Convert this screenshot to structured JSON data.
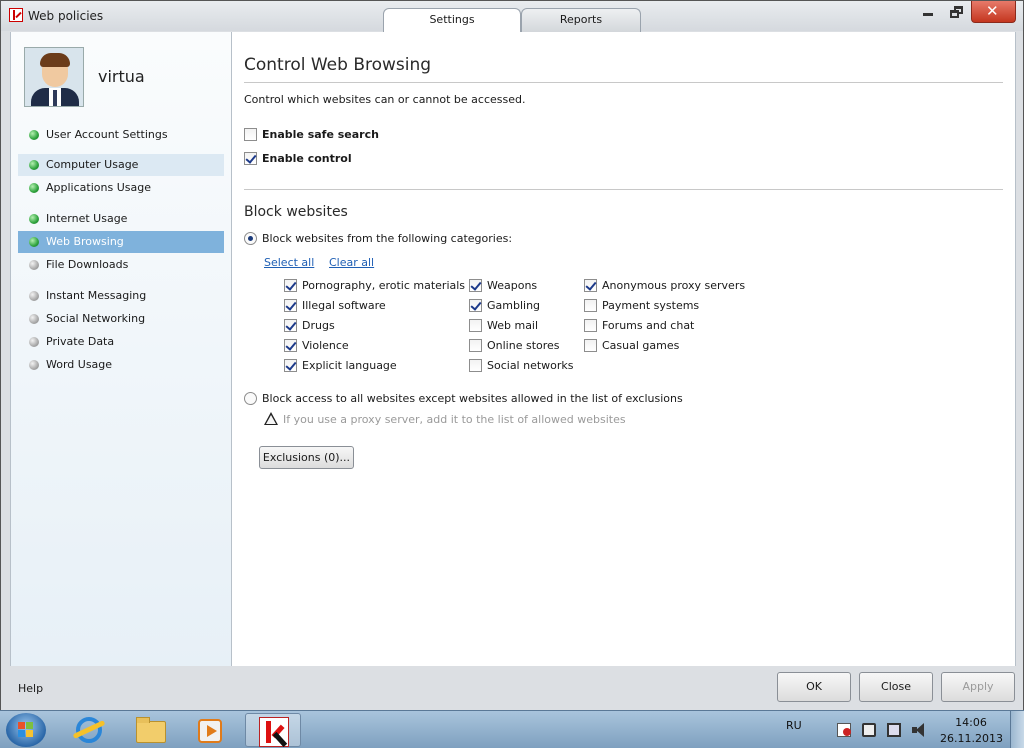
{
  "window": {
    "title": "Web policies",
    "tabs": [
      {
        "label": "Settings",
        "active": true
      },
      {
        "label": "Reports",
        "active": false
      }
    ],
    "close_glyph": "✕"
  },
  "sidebar": {
    "username": "virtua",
    "items": [
      {
        "label": "User Account Settings",
        "status": "green"
      },
      {
        "label": "Computer Usage",
        "status": "green",
        "state": "hover"
      },
      {
        "label": "Applications Usage",
        "status": "green"
      },
      {
        "label": "Internet Usage",
        "status": "green"
      },
      {
        "label": "Web Browsing",
        "status": "green",
        "state": "selected"
      },
      {
        "label": "File Downloads",
        "status": "gray"
      },
      {
        "label": "Instant Messaging",
        "status": "gray"
      },
      {
        "label": "Social Networking",
        "status": "gray"
      },
      {
        "label": "Private Data",
        "status": "gray"
      },
      {
        "label": "Word Usage",
        "status": "gray"
      }
    ]
  },
  "main": {
    "title": "Control Web Browsing",
    "description": "Control which websites can or cannot be accessed.",
    "enable_safe_search": {
      "label": "Enable safe search",
      "checked": false
    },
    "enable_control": {
      "label": "Enable control",
      "checked": true
    },
    "block_title": "Block websites",
    "radio_categories": {
      "label": "Block websites from the following categories:",
      "selected": true
    },
    "select_all": "Select all",
    "clear_all": "Clear all",
    "categories": [
      {
        "label": "Pornography, erotic materials",
        "checked": true
      },
      {
        "label": "Illegal software",
        "checked": true
      },
      {
        "label": "Drugs",
        "checked": true
      },
      {
        "label": "Violence",
        "checked": true
      },
      {
        "label": "Explicit language",
        "checked": true
      },
      {
        "label": "Weapons",
        "checked": true
      },
      {
        "label": "Gambling",
        "checked": true
      },
      {
        "label": "Web mail",
        "checked": false
      },
      {
        "label": "Online stores",
        "checked": false
      },
      {
        "label": "Social networks",
        "checked": false
      },
      {
        "label": "Anonymous proxy servers",
        "checked": true
      },
      {
        "label": "Payment systems",
        "checked": false
      },
      {
        "label": "Forums and chat",
        "checked": false
      },
      {
        "label": "Casual games",
        "checked": false
      }
    ],
    "radio_all": {
      "label": "Block access to all websites except websites allowed in the list of exclusions",
      "selected": false
    },
    "warning": "If you use a proxy server, add it to the list of allowed websites",
    "exclusions_button": "Exclusions (0)..."
  },
  "footer": {
    "help": "Help",
    "ok": "OK",
    "close": "Close",
    "apply": "Apply"
  },
  "taskbar": {
    "language": "RU",
    "time": "14:06",
    "date": "26.11.2013"
  },
  "colors": {
    "selected_nav": "#7fb2dc",
    "link": "#1f5fb4",
    "close_button": "#c4361f"
  }
}
